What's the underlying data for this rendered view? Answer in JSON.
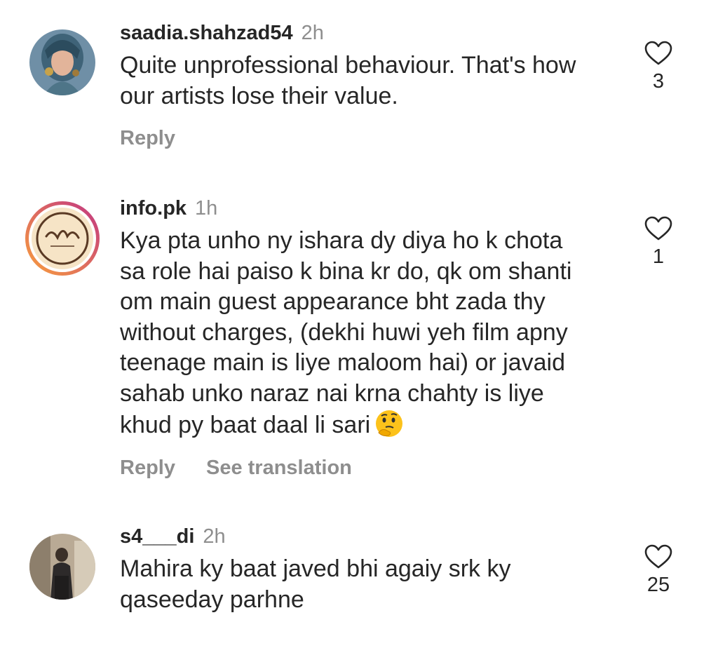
{
  "comments": [
    {
      "username": "saadia.shahzad54",
      "time": "2h",
      "text": "Quite unprofessional behaviour. That's how\nour artists lose their value.",
      "likes": "3",
      "reply_label": "Reply"
    },
    {
      "username": "info.pk",
      "time": "1h",
      "text": "Kya pta  unho  ny ishara dy diya  ho k chota\nsa role hai paiso k bina kr do, qk om shanti\nom main guest appearance bht zada thy\nwithout charges, (dekhi huwi yeh film apny\nteenage main is liye maloom hai) or javaid\nsahab unko naraz nai krna chahty is liye\nkhud py baat daal li sari",
      "emoji": "thinking-face",
      "likes": "1",
      "reply_label": "Reply",
      "translate_label": "See translation"
    },
    {
      "username": "s4___di",
      "time": "2h",
      "text": "Mahira ky baat javed bhi agaiy srk ky\nqaseeday parhne",
      "likes": "25"
    }
  ],
  "colors": {
    "text": "#262626",
    "muted": "#8e8e8e",
    "story_ring_start": "#f9a03c",
    "story_ring_end": "#c13584"
  }
}
